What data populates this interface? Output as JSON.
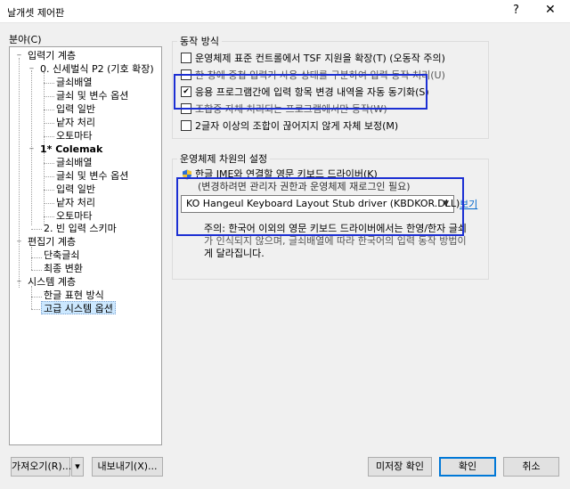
{
  "window": {
    "title": "날개셋 제어판",
    "help_label": "?",
    "close_label": "✕"
  },
  "tree": {
    "label": "분야(C)",
    "items": [
      {
        "label": "입력기 계층",
        "expander": "−"
      },
      {
        "label": "0. 신세벌식 P2 (기호 확장)",
        "expander": "−"
      },
      {
        "label": "글쇠배열"
      },
      {
        "label": "글쇠 및 변수 옵션"
      },
      {
        "label": "입력 일반"
      },
      {
        "label": "낱자 처리"
      },
      {
        "label": "오토마타"
      },
      {
        "label": "1* Colemak",
        "expander": "−"
      },
      {
        "label": "글쇠배열"
      },
      {
        "label": "글쇠 및 변수 옵션"
      },
      {
        "label": "입력 일반"
      },
      {
        "label": "낱자 처리"
      },
      {
        "label": "오토마타"
      },
      {
        "label": "2. 빈 입력 스키마"
      },
      {
        "label": "편집기 계층",
        "expander": "−"
      },
      {
        "label": "단축글쇠"
      },
      {
        "label": "최종 변환"
      },
      {
        "label": "시스템 계층",
        "expander": "−"
      },
      {
        "label": "한글 표현 방식"
      },
      {
        "label": "고급 시스템 옵션"
      }
    ]
  },
  "behavior_group": {
    "title": "동작 방식",
    "options": [
      {
        "label": "운영체제 표준 컨트롤에서 TSF 지원을 확장(T) (오동작 주의)",
        "checked": false
      },
      {
        "label": "한 창에 중첩 입력기 사용 상태를 구분하여 입력 동작 처리(U)",
        "checked": false
      },
      {
        "label": "응용 프로그램간에 입력 항목 변경 내역을 자동 동기화(S)",
        "checked": true
      },
      {
        "label": "조합중 자체 처리되는 프로그램에서만 동작(W)",
        "checked": false
      },
      {
        "label": "2글자 이상의 조합이 끊어지지 않게 자체 보정(M)",
        "checked": false
      }
    ]
  },
  "os_group": {
    "title": "운영체제 차원의 설정",
    "ime_label": "한글 IME와 연결할 영문 키보드 드라이버(K)",
    "admin_note": "(변경하려면 관리자 권한과 운영체제 재로그인 필요)",
    "driver_value": "KO Hangeul Keyboard Layout Stub driver (KBDKOR.DLL)",
    "link_label": "보기",
    "note_line1": "주의: 한국어 이외의 영문 키보드 드라이버에서는 한영/한자 글쇠",
    "note_line2": "가 인식되지 않으며, 글쇠배열에 따라 한국어의 입력 동작 방법이",
    "note_line3": "게 달라집니다."
  },
  "buttons": {
    "import": "가져오기(R)...",
    "import_arrow": "▾",
    "export": "내보내기(X)...",
    "preview": "미저장 확인",
    "ok": "확인",
    "cancel": "취소"
  },
  "colors": {
    "highlight_box": "#1c2fd3",
    "tree_selection": "#cce8ff",
    "default_button_border": "#0078d7"
  }
}
